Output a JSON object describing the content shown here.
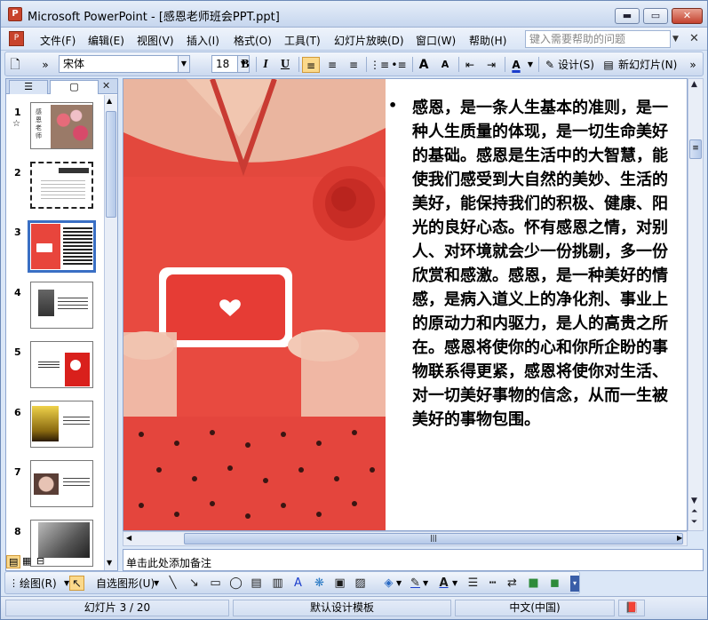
{
  "window": {
    "title": "Microsoft PowerPoint - [感恩老师班会PPT.ppt]",
    "app_icon": "P",
    "controls": {
      "minimize": "▬",
      "maximize": "▭",
      "close": "✕"
    }
  },
  "menubar": {
    "items": [
      "文件(F)",
      "编辑(E)",
      "视图(V)",
      "插入(I)",
      "格式(O)",
      "工具(T)",
      "幻灯片放映(D)",
      "窗口(W)",
      "帮助(H)"
    ],
    "help_placeholder": "键入需要帮助的问题",
    "close_glyph": "✕"
  },
  "toolbar": {
    "font_name": "宋体",
    "font_size": "18",
    "bold": "B",
    "italic": "I",
    "underline": "U",
    "design_label": "设计(S)",
    "new_slide_label": "新幻灯片(N)",
    "grow_font": "A",
    "shrink_font": "A",
    "font_color": "A"
  },
  "panel": {
    "tab_outline_icon": "outline-icon",
    "tab_slides_icon": "slides-icon",
    "close_glyph": "✕",
    "slides": [
      {
        "num": "1",
        "theme": "flowers"
      },
      {
        "num": "2",
        "theme": "frame"
      },
      {
        "num": "3",
        "theme": "red-heart",
        "selected": true
      },
      {
        "num": "4",
        "theme": "photo-text"
      },
      {
        "num": "5",
        "theme": "red-block"
      },
      {
        "num": "6",
        "theme": "sunset"
      },
      {
        "num": "7",
        "theme": "hands"
      },
      {
        "num": "8",
        "theme": "bw-photo"
      }
    ],
    "slide1_transition_icon": "☆"
  },
  "slide": {
    "bullet": "•",
    "body_text": "感恩，是一条人生基本的准则，是一种人生质量的体现，是一切生命美好的基础。感恩是生活中的大智慧，能使我们感受到大自然的美妙、生活的美好，能保持我们的积极、健康、阳光的良好心态。怀有感恩之情，对别人、对环境就会少一份挑剔，多一份欣赏和感激。感恩，是一种美好的情感，是病入道义上的净化剂、事业上的原动力和内驱力，是人的高贵之所在。感恩将使你的心和你所企盼的事物联系得更紧，感恩将使你对生活、对一切美好事物的信念，从而一生被美好的事物包围。"
  },
  "notes": {
    "placeholder": "单击此处添加备注"
  },
  "drawbar": {
    "draw_label": "绘图(R)",
    "autoshapes_label": "自选图形(U)"
  },
  "statusbar": {
    "slide_position": "幻灯片 3 / 20",
    "template": "默认设计模板",
    "language": "中文(中国)"
  },
  "colors": {
    "accent_red": "#e8453c",
    "selection_border": "#3a6fc4",
    "chrome": "#dbe7f7"
  }
}
